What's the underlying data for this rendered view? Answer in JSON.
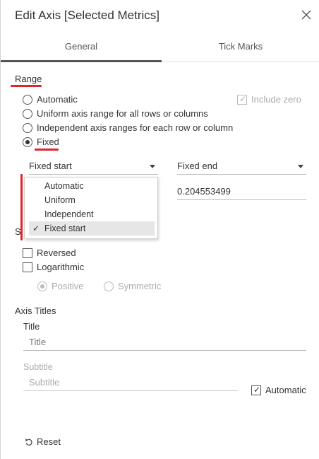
{
  "dialog": {
    "title": "Edit Axis [Selected Metrics]",
    "close_icon": "close-icon"
  },
  "tabs": [
    {
      "label": "General",
      "active": true
    },
    {
      "label": "Tick Marks",
      "active": false
    }
  ],
  "range": {
    "heading": "Range",
    "options": [
      {
        "label": "Automatic",
        "selected": false
      },
      {
        "label": "Uniform axis range for all rows or columns",
        "selected": false
      },
      {
        "label": "Independent axis ranges for each row or column",
        "selected": false
      },
      {
        "label": "Fixed",
        "selected": true
      }
    ],
    "include_zero": {
      "label": "Include zero",
      "checked": true,
      "disabled": true
    },
    "fixed_start": {
      "label": "Fixed start"
    },
    "fixed_end": {
      "label": "Fixed end",
      "value": "0.204553499"
    },
    "start_menu": {
      "items": [
        {
          "label": "Automatic",
          "checked": false
        },
        {
          "label": "Uniform",
          "checked": false
        },
        {
          "label": "Independent",
          "checked": false
        },
        {
          "label": "Fixed start",
          "checked": true
        }
      ]
    }
  },
  "scale": {
    "heading_visible": "S",
    "reversed": {
      "label": "Reversed",
      "checked": false
    },
    "logarithmic": {
      "label": "Logarithmic",
      "checked": false
    },
    "positive": {
      "label": "Positive",
      "selected": true,
      "disabled": true
    },
    "symmetric": {
      "label": "Symmetric",
      "selected": false,
      "disabled": true
    }
  },
  "axis_titles": {
    "heading": "Axis Titles",
    "title_label": "Title",
    "title_placeholder": "Title",
    "subtitle_label": "Subtitle",
    "subtitle_placeholder": "Subtitle",
    "automatic": {
      "label": "Automatic",
      "checked": true
    }
  },
  "footer": {
    "reset_label": "Reset",
    "reset_icon": "undo-icon"
  },
  "colors": {
    "annotation_red": "#e0242c",
    "active_tab_border": "#555555"
  }
}
